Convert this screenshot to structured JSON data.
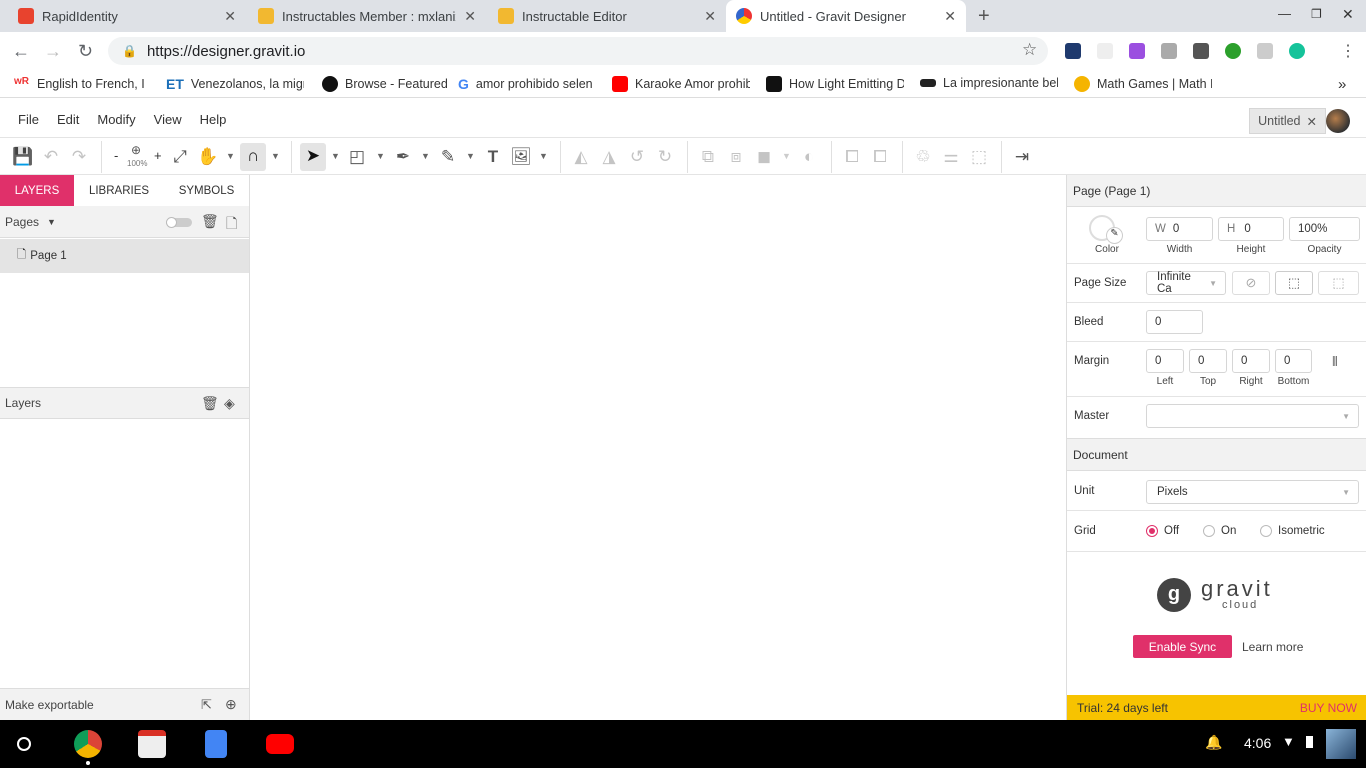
{
  "browser": {
    "tabs": [
      {
        "title": "RapidIdentity",
        "active": false
      },
      {
        "title": "Instructables Member : mxlanix",
        "active": false
      },
      {
        "title": "Instructable Editor",
        "active": false
      },
      {
        "title": "Untitled - Gravit Designer",
        "active": true
      }
    ],
    "url": "https://designer.gravit.io",
    "bookmarks": [
      "English to French, Ita",
      "Venezolanos, la migr",
      "Browse - Featured",
      "amor prohibido selen",
      "Karaoke Amor prohib",
      "How Light Emitting D",
      "La impresionante bel",
      "Math Games | Math I"
    ],
    "more_bookmarks": "»"
  },
  "app": {
    "menu": [
      "File",
      "Edit",
      "Modify",
      "View",
      "Help"
    ],
    "doc_tab": "Untitled",
    "zoom": "100%",
    "zoom_minus": "-",
    "zoom_plus": "+",
    "left_tabs": [
      "LAYERS",
      "LIBRARIES",
      "SYMBOLS"
    ],
    "pages_label": "Pages",
    "pages": [
      "Page 1"
    ],
    "layers_label": "Layers",
    "make_exportable": "Make exportable",
    "accent": "#e0306a"
  },
  "inspector": {
    "title": "Page (Page 1)",
    "color_label": "Color",
    "width": {
      "prefix": "W",
      "value": "0",
      "label": "Width"
    },
    "height": {
      "prefix": "H",
      "value": "0",
      "label": "Height"
    },
    "opacity": {
      "value": "100%",
      "label": "Opacity"
    },
    "page_size_label": "Page Size",
    "page_size_value": "Infinite Ca",
    "bleed_label": "Bleed",
    "bleed_value": "0",
    "margin_label": "Margin",
    "margins": [
      {
        "value": "0",
        "label": "Left"
      },
      {
        "value": "0",
        "label": "Top"
      },
      {
        "value": "0",
        "label": "Right"
      },
      {
        "value": "0",
        "label": "Bottom"
      }
    ],
    "master_label": "Master",
    "master_value": "",
    "document_title": "Document",
    "unit_label": "Unit",
    "unit_value": "Pixels",
    "grid_label": "Grid",
    "grid_options": [
      "Off",
      "On",
      "Isometric"
    ],
    "grid_selected": "Off",
    "cloud_brand": "gravit",
    "cloud_sub": "cloud",
    "enable_sync": "Enable Sync",
    "learn_more": "Learn more",
    "trial": "Trial: 24 days left",
    "buy_now": "BUY NOW"
  },
  "taskbar": {
    "time": "4:06"
  }
}
